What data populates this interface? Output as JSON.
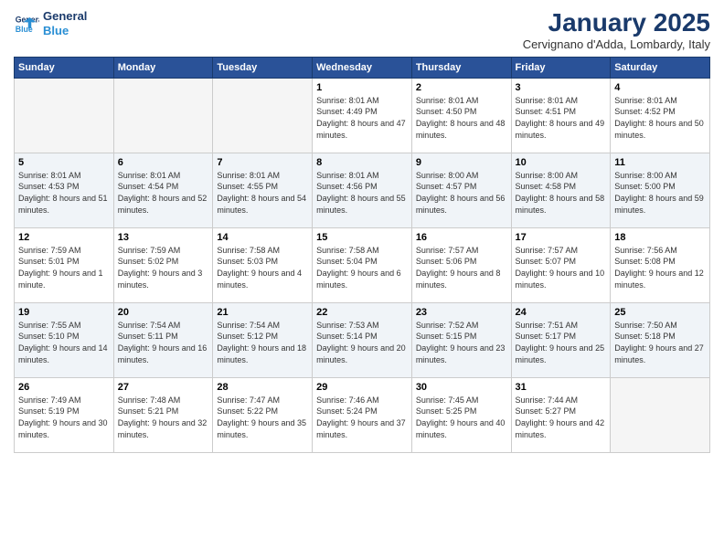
{
  "logo": {
    "line1": "General",
    "line2": "Blue"
  },
  "title": "January 2025",
  "subtitle": "Cervignano d'Adda, Lombardy, Italy",
  "weekdays": [
    "Sunday",
    "Monday",
    "Tuesday",
    "Wednesday",
    "Thursday",
    "Friday",
    "Saturday"
  ],
  "weeks": [
    [
      {
        "day": "",
        "info": ""
      },
      {
        "day": "",
        "info": ""
      },
      {
        "day": "",
        "info": ""
      },
      {
        "day": "1",
        "info": "Sunrise: 8:01 AM\nSunset: 4:49 PM\nDaylight: 8 hours and 47 minutes."
      },
      {
        "day": "2",
        "info": "Sunrise: 8:01 AM\nSunset: 4:50 PM\nDaylight: 8 hours and 48 minutes."
      },
      {
        "day": "3",
        "info": "Sunrise: 8:01 AM\nSunset: 4:51 PM\nDaylight: 8 hours and 49 minutes."
      },
      {
        "day": "4",
        "info": "Sunrise: 8:01 AM\nSunset: 4:52 PM\nDaylight: 8 hours and 50 minutes."
      }
    ],
    [
      {
        "day": "5",
        "info": "Sunrise: 8:01 AM\nSunset: 4:53 PM\nDaylight: 8 hours and 51 minutes."
      },
      {
        "day": "6",
        "info": "Sunrise: 8:01 AM\nSunset: 4:54 PM\nDaylight: 8 hours and 52 minutes."
      },
      {
        "day": "7",
        "info": "Sunrise: 8:01 AM\nSunset: 4:55 PM\nDaylight: 8 hours and 54 minutes."
      },
      {
        "day": "8",
        "info": "Sunrise: 8:01 AM\nSunset: 4:56 PM\nDaylight: 8 hours and 55 minutes."
      },
      {
        "day": "9",
        "info": "Sunrise: 8:00 AM\nSunset: 4:57 PM\nDaylight: 8 hours and 56 minutes."
      },
      {
        "day": "10",
        "info": "Sunrise: 8:00 AM\nSunset: 4:58 PM\nDaylight: 8 hours and 58 minutes."
      },
      {
        "day": "11",
        "info": "Sunrise: 8:00 AM\nSunset: 5:00 PM\nDaylight: 8 hours and 59 minutes."
      }
    ],
    [
      {
        "day": "12",
        "info": "Sunrise: 7:59 AM\nSunset: 5:01 PM\nDaylight: 9 hours and 1 minute."
      },
      {
        "day": "13",
        "info": "Sunrise: 7:59 AM\nSunset: 5:02 PM\nDaylight: 9 hours and 3 minutes."
      },
      {
        "day": "14",
        "info": "Sunrise: 7:58 AM\nSunset: 5:03 PM\nDaylight: 9 hours and 4 minutes."
      },
      {
        "day": "15",
        "info": "Sunrise: 7:58 AM\nSunset: 5:04 PM\nDaylight: 9 hours and 6 minutes."
      },
      {
        "day": "16",
        "info": "Sunrise: 7:57 AM\nSunset: 5:06 PM\nDaylight: 9 hours and 8 minutes."
      },
      {
        "day": "17",
        "info": "Sunrise: 7:57 AM\nSunset: 5:07 PM\nDaylight: 9 hours and 10 minutes."
      },
      {
        "day": "18",
        "info": "Sunrise: 7:56 AM\nSunset: 5:08 PM\nDaylight: 9 hours and 12 minutes."
      }
    ],
    [
      {
        "day": "19",
        "info": "Sunrise: 7:55 AM\nSunset: 5:10 PM\nDaylight: 9 hours and 14 minutes."
      },
      {
        "day": "20",
        "info": "Sunrise: 7:54 AM\nSunset: 5:11 PM\nDaylight: 9 hours and 16 minutes."
      },
      {
        "day": "21",
        "info": "Sunrise: 7:54 AM\nSunset: 5:12 PM\nDaylight: 9 hours and 18 minutes."
      },
      {
        "day": "22",
        "info": "Sunrise: 7:53 AM\nSunset: 5:14 PM\nDaylight: 9 hours and 20 minutes."
      },
      {
        "day": "23",
        "info": "Sunrise: 7:52 AM\nSunset: 5:15 PM\nDaylight: 9 hours and 23 minutes."
      },
      {
        "day": "24",
        "info": "Sunrise: 7:51 AM\nSunset: 5:17 PM\nDaylight: 9 hours and 25 minutes."
      },
      {
        "day": "25",
        "info": "Sunrise: 7:50 AM\nSunset: 5:18 PM\nDaylight: 9 hours and 27 minutes."
      }
    ],
    [
      {
        "day": "26",
        "info": "Sunrise: 7:49 AM\nSunset: 5:19 PM\nDaylight: 9 hours and 30 minutes."
      },
      {
        "day": "27",
        "info": "Sunrise: 7:48 AM\nSunset: 5:21 PM\nDaylight: 9 hours and 32 minutes."
      },
      {
        "day": "28",
        "info": "Sunrise: 7:47 AM\nSunset: 5:22 PM\nDaylight: 9 hours and 35 minutes."
      },
      {
        "day": "29",
        "info": "Sunrise: 7:46 AM\nSunset: 5:24 PM\nDaylight: 9 hours and 37 minutes."
      },
      {
        "day": "30",
        "info": "Sunrise: 7:45 AM\nSunset: 5:25 PM\nDaylight: 9 hours and 40 minutes."
      },
      {
        "day": "31",
        "info": "Sunrise: 7:44 AM\nSunset: 5:27 PM\nDaylight: 9 hours and 42 minutes."
      },
      {
        "day": "",
        "info": ""
      }
    ]
  ]
}
